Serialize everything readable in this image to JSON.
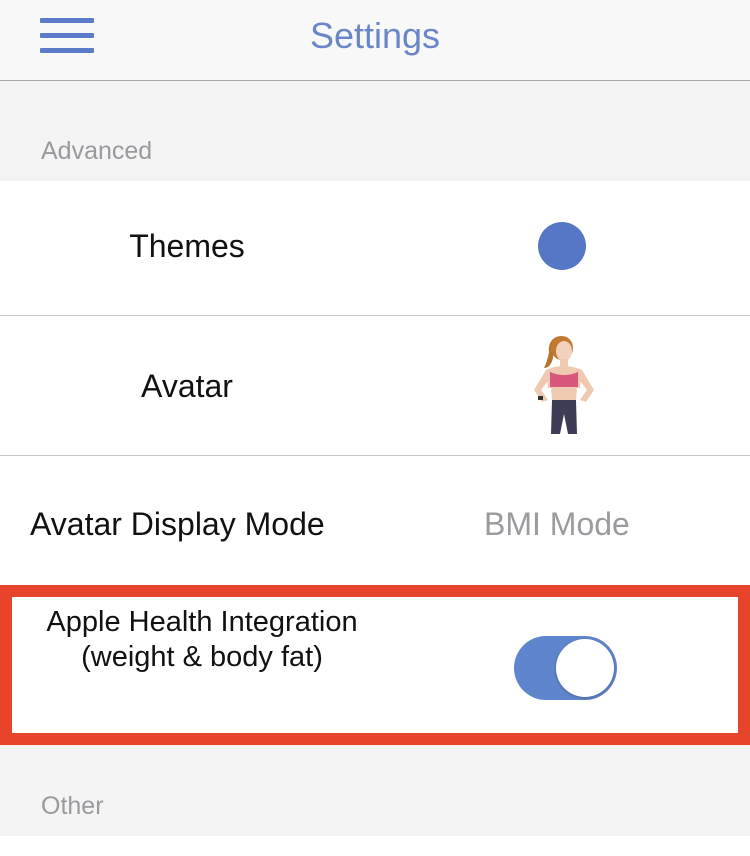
{
  "header": {
    "title": "Settings",
    "menu_icon": "hamburger-menu-icon"
  },
  "sections": {
    "advanced": {
      "label": "Advanced",
      "rows": {
        "themes": {
          "label": "Themes",
          "color": "#5677c5"
        },
        "avatar": {
          "label": "Avatar"
        },
        "display_mode": {
          "label": "Avatar Display Mode",
          "value": "BMI Mode"
        },
        "health": {
          "label_line1": "Apple Health Integration",
          "label_line2": "(weight & body fat)",
          "enabled": true
        }
      }
    },
    "other": {
      "label": "Other"
    }
  },
  "colors": {
    "accent": "#5f86cc",
    "highlight": "#e8432b"
  }
}
